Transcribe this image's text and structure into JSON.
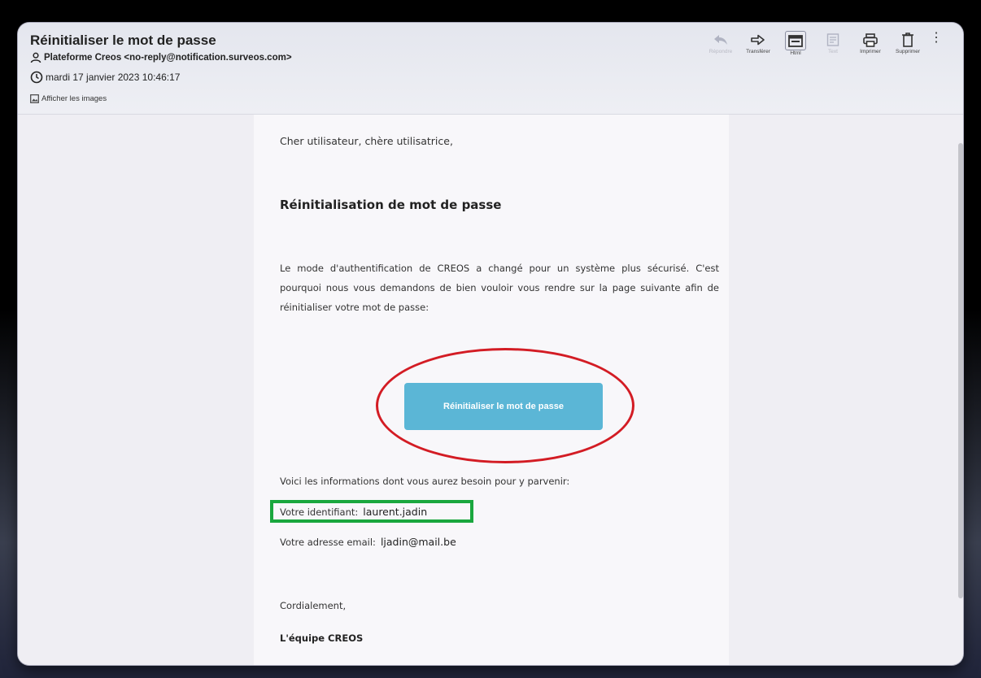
{
  "email": {
    "subject": "Réinitialiser le mot de passe",
    "from": "Plateforme Creos <no-reply@notification.surveos.com>",
    "date": "mardi 17 janvier 2023 10:46:17",
    "show_images": "Afficher les images"
  },
  "toolbar": {
    "reply": "Répondre",
    "forward": "Transférer",
    "html": "Html",
    "text": "Text",
    "print": "Imprimer",
    "delete": "Supprimer",
    "more": "⋮"
  },
  "body": {
    "greeting": "Cher utilisateur, chère utilisatrice,",
    "heading": "Réinitialisation de mot de passe",
    "paragraph": "Le mode d'authentification de CREOS a changé pour un système plus sécurisé. C'est pourquoi nous vous demandons de bien vouloir vous rendre sur la page suivante afin de réinitialiser votre mot de passe:",
    "button_label": "Réinitialiser le mot de passe",
    "info_intro": "Voici les informations dont vous aurez besoin pour y parvenir:",
    "identifier_label": "Votre identifiant:",
    "identifier_value": "laurent.jadin",
    "email_label": "Votre adresse email:",
    "email_value": "ljadin@mail.be",
    "regards": "Cordialement,",
    "team": "L'équipe CREOS"
  },
  "colors": {
    "button": "#5bb6d6",
    "highlight_ellipse": "#d31c24",
    "highlight_box": "#1aa73e"
  }
}
